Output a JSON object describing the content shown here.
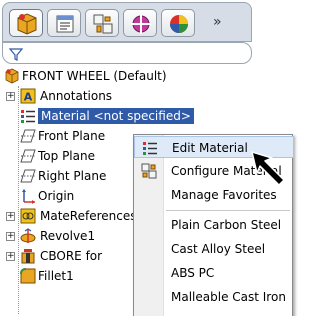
{
  "panel_tabs": [
    {
      "name": "FeatureManager design tree",
      "icon": "feature-tree-icon"
    },
    {
      "name": "PropertyManager",
      "icon": "property-manager-icon"
    },
    {
      "name": "ConfigurationManager",
      "icon": "configuration-manager-icon"
    },
    {
      "name": "DimXpertManager",
      "icon": "dimxpert-icon"
    },
    {
      "name": "DisplayManager",
      "icon": "display-manager-icon"
    }
  ],
  "more_tabs_label": "»",
  "filter": {
    "icon": "filter-icon"
  },
  "tree": {
    "root_label": "FRONT WHEEL  (Default)",
    "items": [
      {
        "label": "Annotations",
        "icon": "annotations-icon",
        "expander": "+"
      },
      {
        "label": "Material <not specified>",
        "icon": "material-icon",
        "expander": ""
      },
      {
        "label": "Front Plane",
        "icon": "plane-icon",
        "expander": ""
      },
      {
        "label": "Top Plane",
        "icon": "plane-icon",
        "expander": ""
      },
      {
        "label": "Right Plane",
        "icon": "plane-icon",
        "expander": ""
      },
      {
        "label": "Origin",
        "icon": "origin-icon",
        "expander": ""
      },
      {
        "label": "MateReferences",
        "icon": "mate-references-icon",
        "expander": "+"
      },
      {
        "label": "Revolve1",
        "icon": "revolve-icon",
        "expander": "+"
      },
      {
        "label": "CBORE for",
        "icon": "hole-wizard-icon",
        "expander": "+"
      },
      {
        "label": "Fillet1",
        "icon": "fillet-icon",
        "expander": ""
      }
    ]
  },
  "context_menu": {
    "items": [
      {
        "label": "Edit Material",
        "icon": "edit-material-icon"
      },
      {
        "label": "Configure Material",
        "icon": "configure-material-icon"
      },
      {
        "label": "Manage Favorites",
        "icon": ""
      },
      {
        "label": "Plain Carbon Steel",
        "icon": ""
      },
      {
        "label": "Cast Alloy Steel",
        "icon": ""
      },
      {
        "label": "ABS PC",
        "icon": ""
      },
      {
        "label": "Malleable Cast Iron",
        "icon": ""
      }
    ]
  },
  "colors": {
    "selection": "#2f5aa8",
    "menu_hover": "#dfeaf8",
    "tab_bg": "#d6dde6"
  }
}
